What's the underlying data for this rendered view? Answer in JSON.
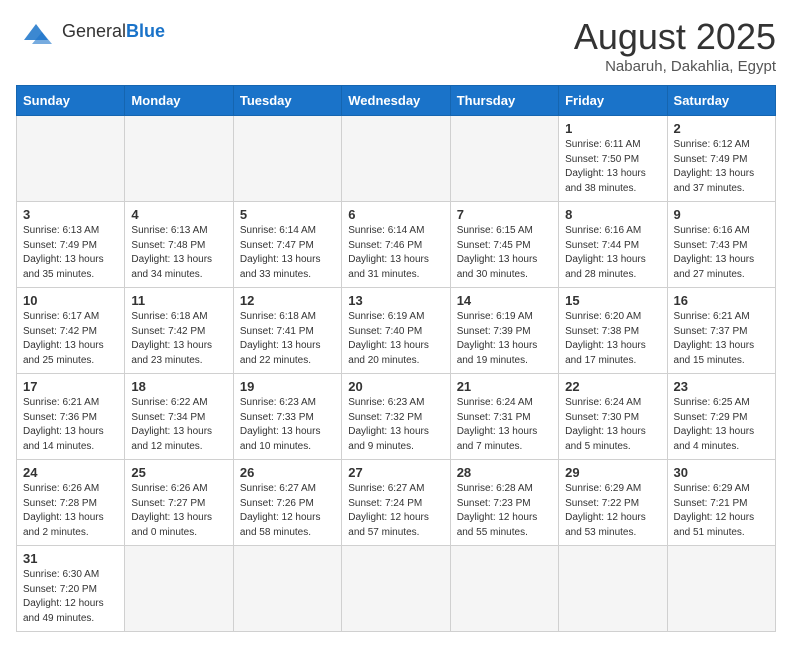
{
  "header": {
    "logo_general": "General",
    "logo_blue": "Blue",
    "month": "August 2025",
    "location": "Nabaruh, Dakahlia, Egypt"
  },
  "weekdays": [
    "Sunday",
    "Monday",
    "Tuesday",
    "Wednesday",
    "Thursday",
    "Friday",
    "Saturday"
  ],
  "weeks": [
    [
      {
        "day": "",
        "info": ""
      },
      {
        "day": "",
        "info": ""
      },
      {
        "day": "",
        "info": ""
      },
      {
        "day": "",
        "info": ""
      },
      {
        "day": "",
        "info": ""
      },
      {
        "day": "1",
        "info": "Sunrise: 6:11 AM\nSunset: 7:50 PM\nDaylight: 13 hours and 38 minutes."
      },
      {
        "day": "2",
        "info": "Sunrise: 6:12 AM\nSunset: 7:49 PM\nDaylight: 13 hours and 37 minutes."
      }
    ],
    [
      {
        "day": "3",
        "info": "Sunrise: 6:13 AM\nSunset: 7:49 PM\nDaylight: 13 hours and 35 minutes."
      },
      {
        "day": "4",
        "info": "Sunrise: 6:13 AM\nSunset: 7:48 PM\nDaylight: 13 hours and 34 minutes."
      },
      {
        "day": "5",
        "info": "Sunrise: 6:14 AM\nSunset: 7:47 PM\nDaylight: 13 hours and 33 minutes."
      },
      {
        "day": "6",
        "info": "Sunrise: 6:14 AM\nSunset: 7:46 PM\nDaylight: 13 hours and 31 minutes."
      },
      {
        "day": "7",
        "info": "Sunrise: 6:15 AM\nSunset: 7:45 PM\nDaylight: 13 hours and 30 minutes."
      },
      {
        "day": "8",
        "info": "Sunrise: 6:16 AM\nSunset: 7:44 PM\nDaylight: 13 hours and 28 minutes."
      },
      {
        "day": "9",
        "info": "Sunrise: 6:16 AM\nSunset: 7:43 PM\nDaylight: 13 hours and 27 minutes."
      }
    ],
    [
      {
        "day": "10",
        "info": "Sunrise: 6:17 AM\nSunset: 7:42 PM\nDaylight: 13 hours and 25 minutes."
      },
      {
        "day": "11",
        "info": "Sunrise: 6:18 AM\nSunset: 7:42 PM\nDaylight: 13 hours and 23 minutes."
      },
      {
        "day": "12",
        "info": "Sunrise: 6:18 AM\nSunset: 7:41 PM\nDaylight: 13 hours and 22 minutes."
      },
      {
        "day": "13",
        "info": "Sunrise: 6:19 AM\nSunset: 7:40 PM\nDaylight: 13 hours and 20 minutes."
      },
      {
        "day": "14",
        "info": "Sunrise: 6:19 AM\nSunset: 7:39 PM\nDaylight: 13 hours and 19 minutes."
      },
      {
        "day": "15",
        "info": "Sunrise: 6:20 AM\nSunset: 7:38 PM\nDaylight: 13 hours and 17 minutes."
      },
      {
        "day": "16",
        "info": "Sunrise: 6:21 AM\nSunset: 7:37 PM\nDaylight: 13 hours and 15 minutes."
      }
    ],
    [
      {
        "day": "17",
        "info": "Sunrise: 6:21 AM\nSunset: 7:36 PM\nDaylight: 13 hours and 14 minutes."
      },
      {
        "day": "18",
        "info": "Sunrise: 6:22 AM\nSunset: 7:34 PM\nDaylight: 13 hours and 12 minutes."
      },
      {
        "day": "19",
        "info": "Sunrise: 6:23 AM\nSunset: 7:33 PM\nDaylight: 13 hours and 10 minutes."
      },
      {
        "day": "20",
        "info": "Sunrise: 6:23 AM\nSunset: 7:32 PM\nDaylight: 13 hours and 9 minutes."
      },
      {
        "day": "21",
        "info": "Sunrise: 6:24 AM\nSunset: 7:31 PM\nDaylight: 13 hours and 7 minutes."
      },
      {
        "day": "22",
        "info": "Sunrise: 6:24 AM\nSunset: 7:30 PM\nDaylight: 13 hours and 5 minutes."
      },
      {
        "day": "23",
        "info": "Sunrise: 6:25 AM\nSunset: 7:29 PM\nDaylight: 13 hours and 4 minutes."
      }
    ],
    [
      {
        "day": "24",
        "info": "Sunrise: 6:26 AM\nSunset: 7:28 PM\nDaylight: 13 hours and 2 minutes."
      },
      {
        "day": "25",
        "info": "Sunrise: 6:26 AM\nSunset: 7:27 PM\nDaylight: 13 hours and 0 minutes."
      },
      {
        "day": "26",
        "info": "Sunrise: 6:27 AM\nSunset: 7:26 PM\nDaylight: 12 hours and 58 minutes."
      },
      {
        "day": "27",
        "info": "Sunrise: 6:27 AM\nSunset: 7:24 PM\nDaylight: 12 hours and 57 minutes."
      },
      {
        "day": "28",
        "info": "Sunrise: 6:28 AM\nSunset: 7:23 PM\nDaylight: 12 hours and 55 minutes."
      },
      {
        "day": "29",
        "info": "Sunrise: 6:29 AM\nSunset: 7:22 PM\nDaylight: 12 hours and 53 minutes."
      },
      {
        "day": "30",
        "info": "Sunrise: 6:29 AM\nSunset: 7:21 PM\nDaylight: 12 hours and 51 minutes."
      }
    ],
    [
      {
        "day": "31",
        "info": "Sunrise: 6:30 AM\nSunset: 7:20 PM\nDaylight: 12 hours and 49 minutes."
      },
      {
        "day": "",
        "info": ""
      },
      {
        "day": "",
        "info": ""
      },
      {
        "day": "",
        "info": ""
      },
      {
        "day": "",
        "info": ""
      },
      {
        "day": "",
        "info": ""
      },
      {
        "day": "",
        "info": ""
      }
    ]
  ]
}
